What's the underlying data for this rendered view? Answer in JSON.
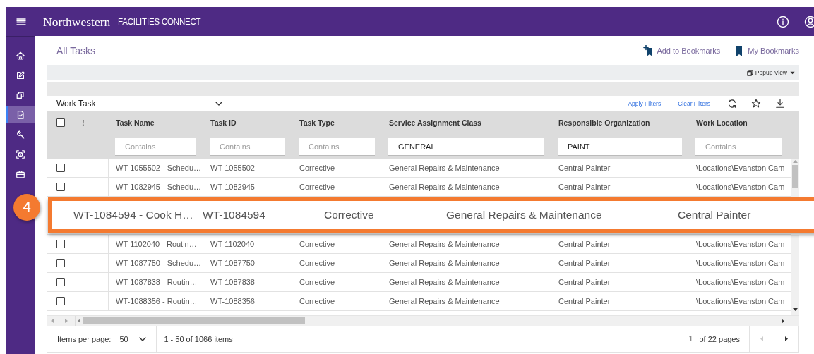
{
  "header": {
    "brand": "Northwestern",
    "product": "FACILITIES CONNECT"
  },
  "sidebar": {
    "items": [
      {
        "kind": "home",
        "selected": false
      },
      {
        "kind": "edit",
        "selected": false
      },
      {
        "kind": "copy",
        "selected": false
      },
      {
        "kind": "document",
        "selected": true
      },
      {
        "kind": "wrench",
        "selected": false
      },
      {
        "kind": "scan",
        "selected": false
      },
      {
        "kind": "briefcase",
        "selected": false
      }
    ]
  },
  "page": {
    "title": "All Tasks",
    "actions": [
      {
        "kind": "add-bookmark",
        "label": "Add to Bookmarks"
      },
      {
        "kind": "bookmarks",
        "label": "My Bookmarks"
      }
    ],
    "popup_view": "Popup View"
  },
  "toolbar": {
    "view": "Work Task",
    "apply": "Apply Filters",
    "clear": "Clear Filters"
  },
  "table": {
    "select_all": {
      "checked": false
    },
    "columns": [
      "!",
      "Task Name",
      "Task ID",
      "Task Type",
      "Service Assignment Class",
      "Responsible Organization",
      "Work Location"
    ],
    "filters": [
      {
        "placeholder": "Contains"
      },
      {
        "placeholder": "Contains"
      },
      {
        "placeholder": "Contains"
      },
      {
        "value": "GENERAL"
      },
      {
        "value": "PAINT"
      },
      {
        "placeholder": "Contains"
      }
    ],
    "rows": [
      {
        "kind": "row",
        "checked": false,
        "cells": [
          "",
          "WT-1055502 - Schedu…",
          "WT-1055502",
          "Corrective",
          "General Repairs & Maintenance",
          "Central Painter",
          "\\Locations\\Evanston Cam"
        ]
      },
      {
        "kind": "row",
        "checked": false,
        "cells": [
          "",
          "WT-1082945 - Schedu…",
          "WT-1082945",
          "Corrective",
          "General Repairs & Maintenance",
          "Central Painter",
          "\\Locations\\Evanston Cam"
        ]
      },
      {
        "kind": "callout",
        "badge": "4",
        "texts": [
          "WT-1084594 - Cook H…",
          "WT-1084594",
          "Corrective",
          "General Repairs & Maintenance",
          "Central Painter"
        ]
      },
      {
        "kind": "row",
        "checked": false,
        "cells": [
          "",
          "WT-1102040 - Routin…",
          "WT-1102040",
          "Corrective",
          "General Repairs & Maintenance",
          "Central Painter",
          "\\Locations\\Evanston Cam"
        ]
      },
      {
        "kind": "row",
        "checked": false,
        "cells": [
          "",
          "WT-1087750 - Schedu…",
          "WT-1087750",
          "Corrective",
          "General Repairs & Maintenance",
          "Central Painter",
          "\\Locations\\Evanston Cam"
        ]
      },
      {
        "kind": "row",
        "checked": false,
        "cells": [
          "",
          "WT-1087838 - Routin…",
          "WT-1087838",
          "Corrective",
          "General Repairs & Maintenance",
          "Central Painter",
          "\\Locations\\Evanston Cam"
        ]
      },
      {
        "kind": "row",
        "checked": false,
        "cells": [
          "",
          "WT-1088356 - Routin…",
          "WT-1088356",
          "Corrective",
          "General Repairs & Maintenance",
          "Central Painter",
          "\\Locations\\Evanston Cam"
        ]
      }
    ]
  },
  "footer": {
    "items_label": "Items per page:",
    "items_value": "50",
    "range": "1 - 50 of 1066 items",
    "page": "1",
    "pages": "of 22 pages"
  }
}
